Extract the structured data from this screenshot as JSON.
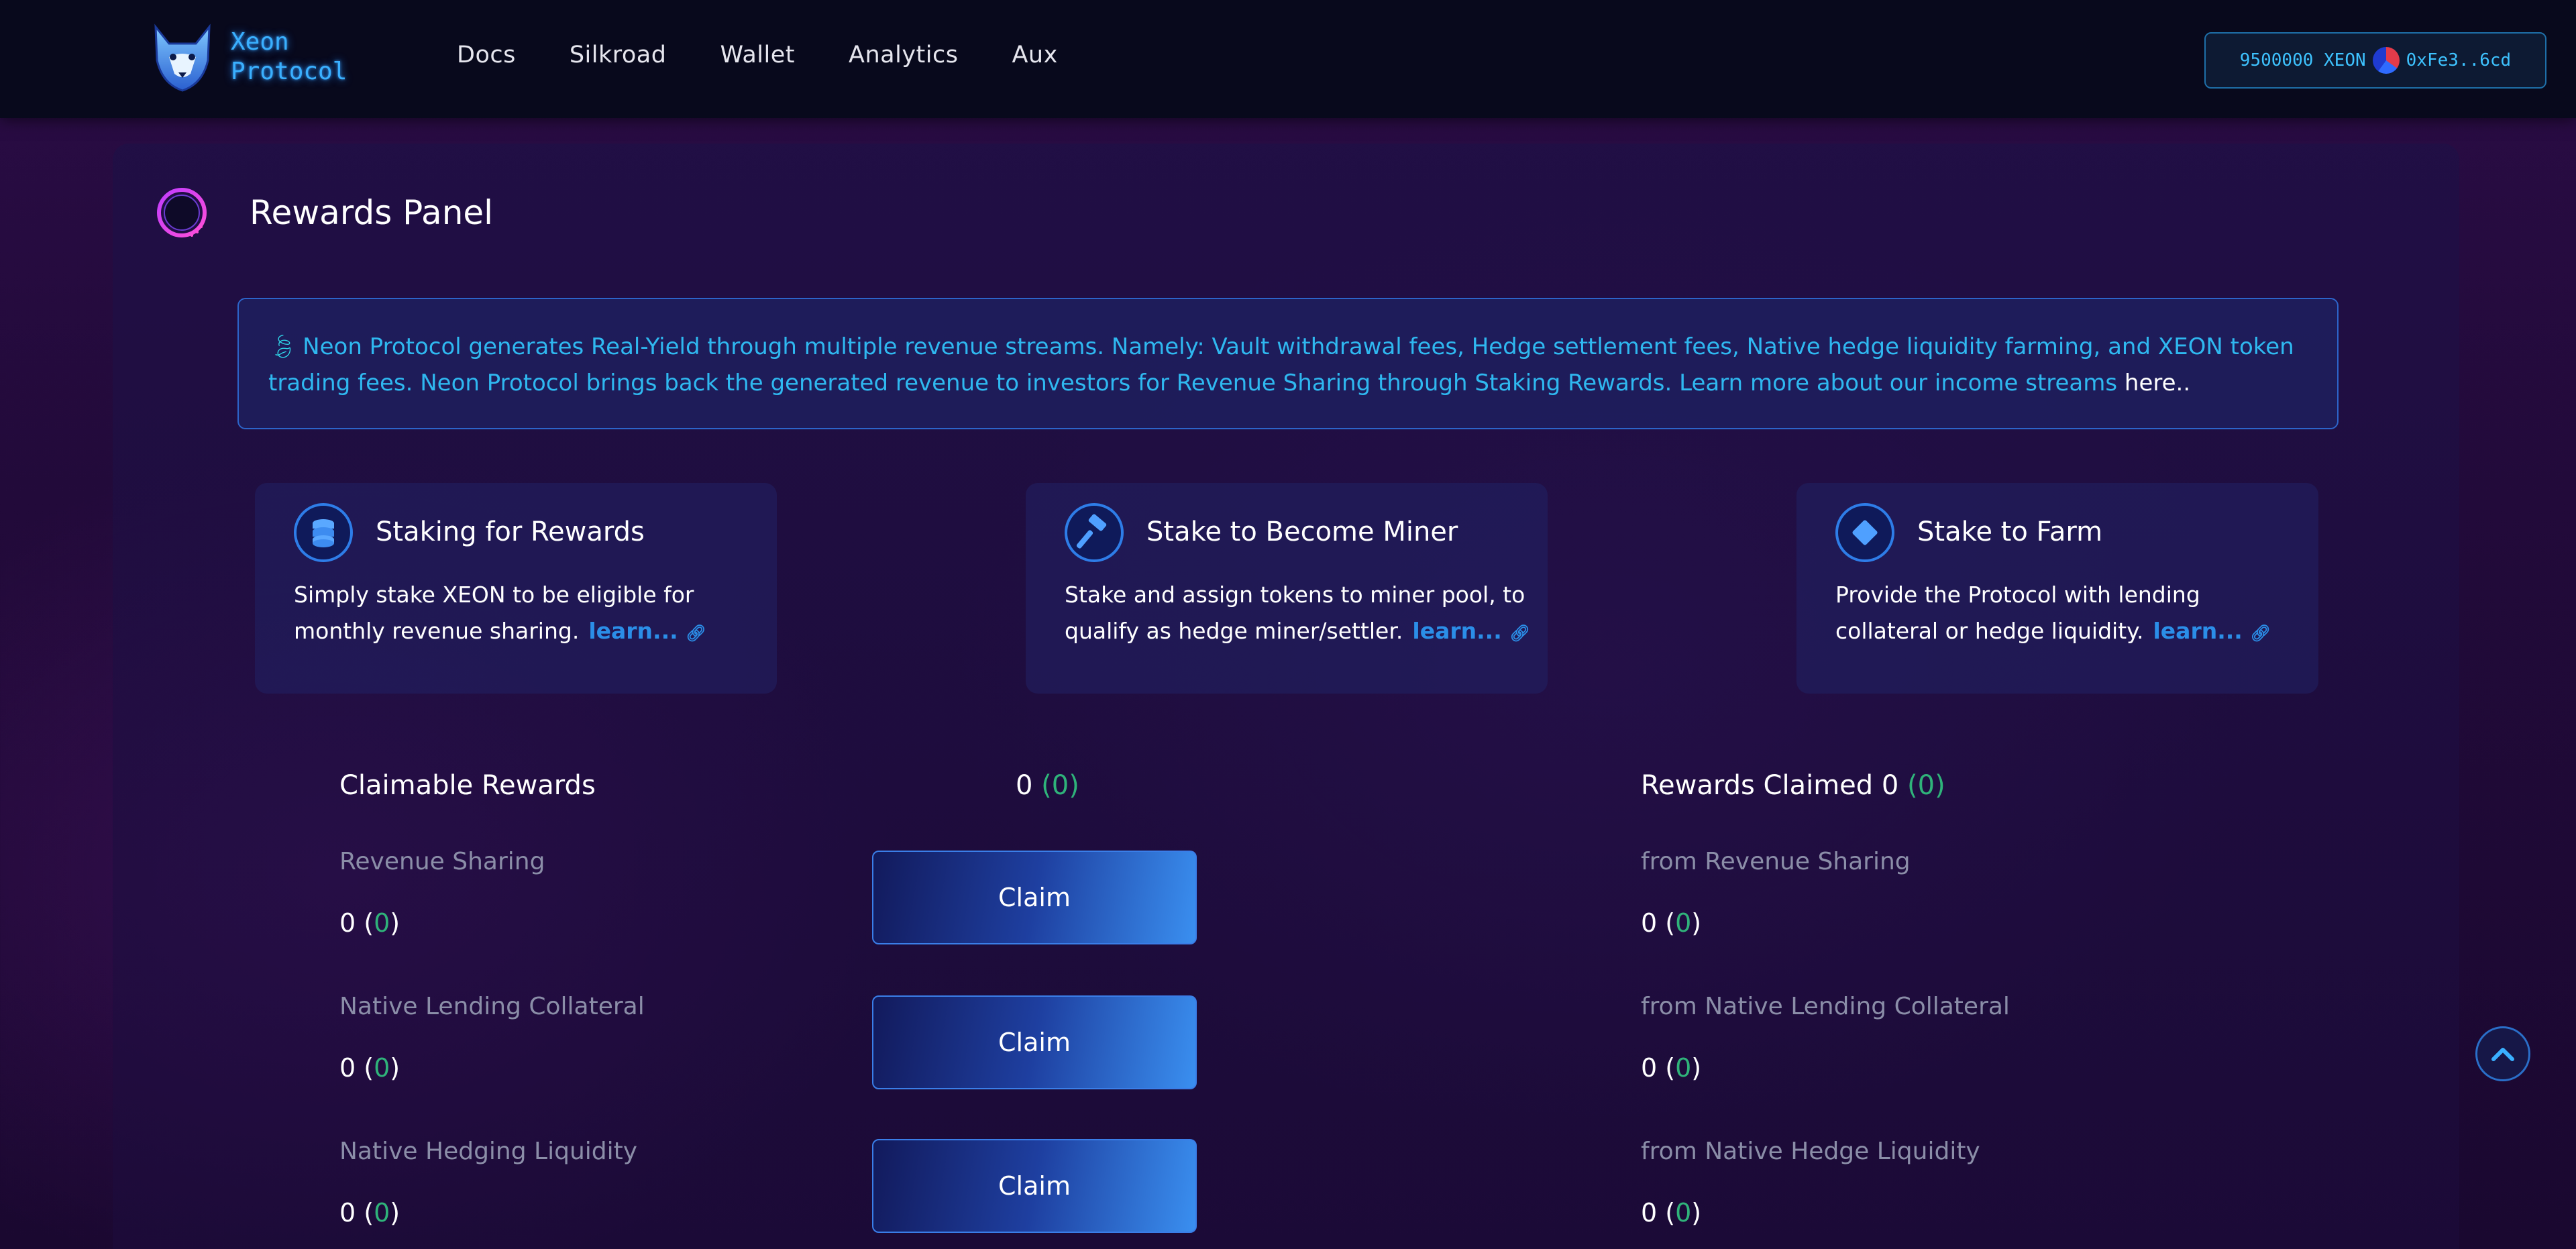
{
  "brand": {
    "line1": "Xeon",
    "line2": "Protocol"
  },
  "nav": {
    "items": [
      "Docs",
      "Silkroad",
      "Wallet",
      "Analytics",
      "Aux"
    ]
  },
  "wallet": {
    "balance": "9500000 XEON",
    "address": "0xFe3..6cd"
  },
  "panel": {
    "title": "Rewards Panel"
  },
  "info": {
    "text": "Neon Protocol generates Real-Yield through multiple revenue streams. Namely: Vault withdrawal fees, Hedge settlement fees, Native hedge liquidity farming, and XEON token trading fees. Neon Protocol brings back the generated revenue to investors for Revenue Sharing through Staking Rewards. Learn more about our income streams ",
    "link": "here.."
  },
  "cards": [
    {
      "title": "Staking for Rewards",
      "desc": "Simply stake XEON to be eligible for monthly revenue sharing.",
      "learn": "learn..."
    },
    {
      "title": "Stake to Become Miner",
      "desc": "Stake and assign tokens to miner pool, to qualify as hedge miner/settler.",
      "learn": "learn..."
    },
    {
      "title": "Stake to Farm",
      "desc": "Provide the Protocol with lending collateral or hedge liquidity.",
      "learn": "learn..."
    }
  ],
  "claimable": {
    "title": "Claimable Rewards",
    "total": "0",
    "total_sub": "0",
    "claim_label": "Claim",
    "items": [
      {
        "label": "Revenue Sharing",
        "value": "0",
        "sub": "0"
      },
      {
        "label": "Native Lending Collateral",
        "value": "0",
        "sub": "0"
      },
      {
        "label": "Native Hedging Liquidity",
        "value": "0",
        "sub": "0"
      }
    ]
  },
  "claimed": {
    "title": "Rewards Claimed",
    "total": "0",
    "total_sub": "0",
    "items": [
      {
        "label": "from Revenue Sharing",
        "value": "0",
        "sub": "0"
      },
      {
        "label": "from Native Lending Collateral",
        "value": "0",
        "sub": "0"
      },
      {
        "label": "from Native Hedge Liquidity",
        "value": "0",
        "sub": "0"
      }
    ]
  },
  "icons": {
    "logo": "husky-logo-icon",
    "panel": "ring-icon",
    "card1": "coins-icon",
    "card2": "hammer-icon",
    "card3": "diamond-icon",
    "info": "leaf-icon",
    "link": "link-icon",
    "scroll": "chevron-up-icon"
  },
  "colors": {
    "accent": "#2fb8f0",
    "green": "#2fb37a",
    "button": "#3a8ff0",
    "nav_bg": "#08091c"
  }
}
